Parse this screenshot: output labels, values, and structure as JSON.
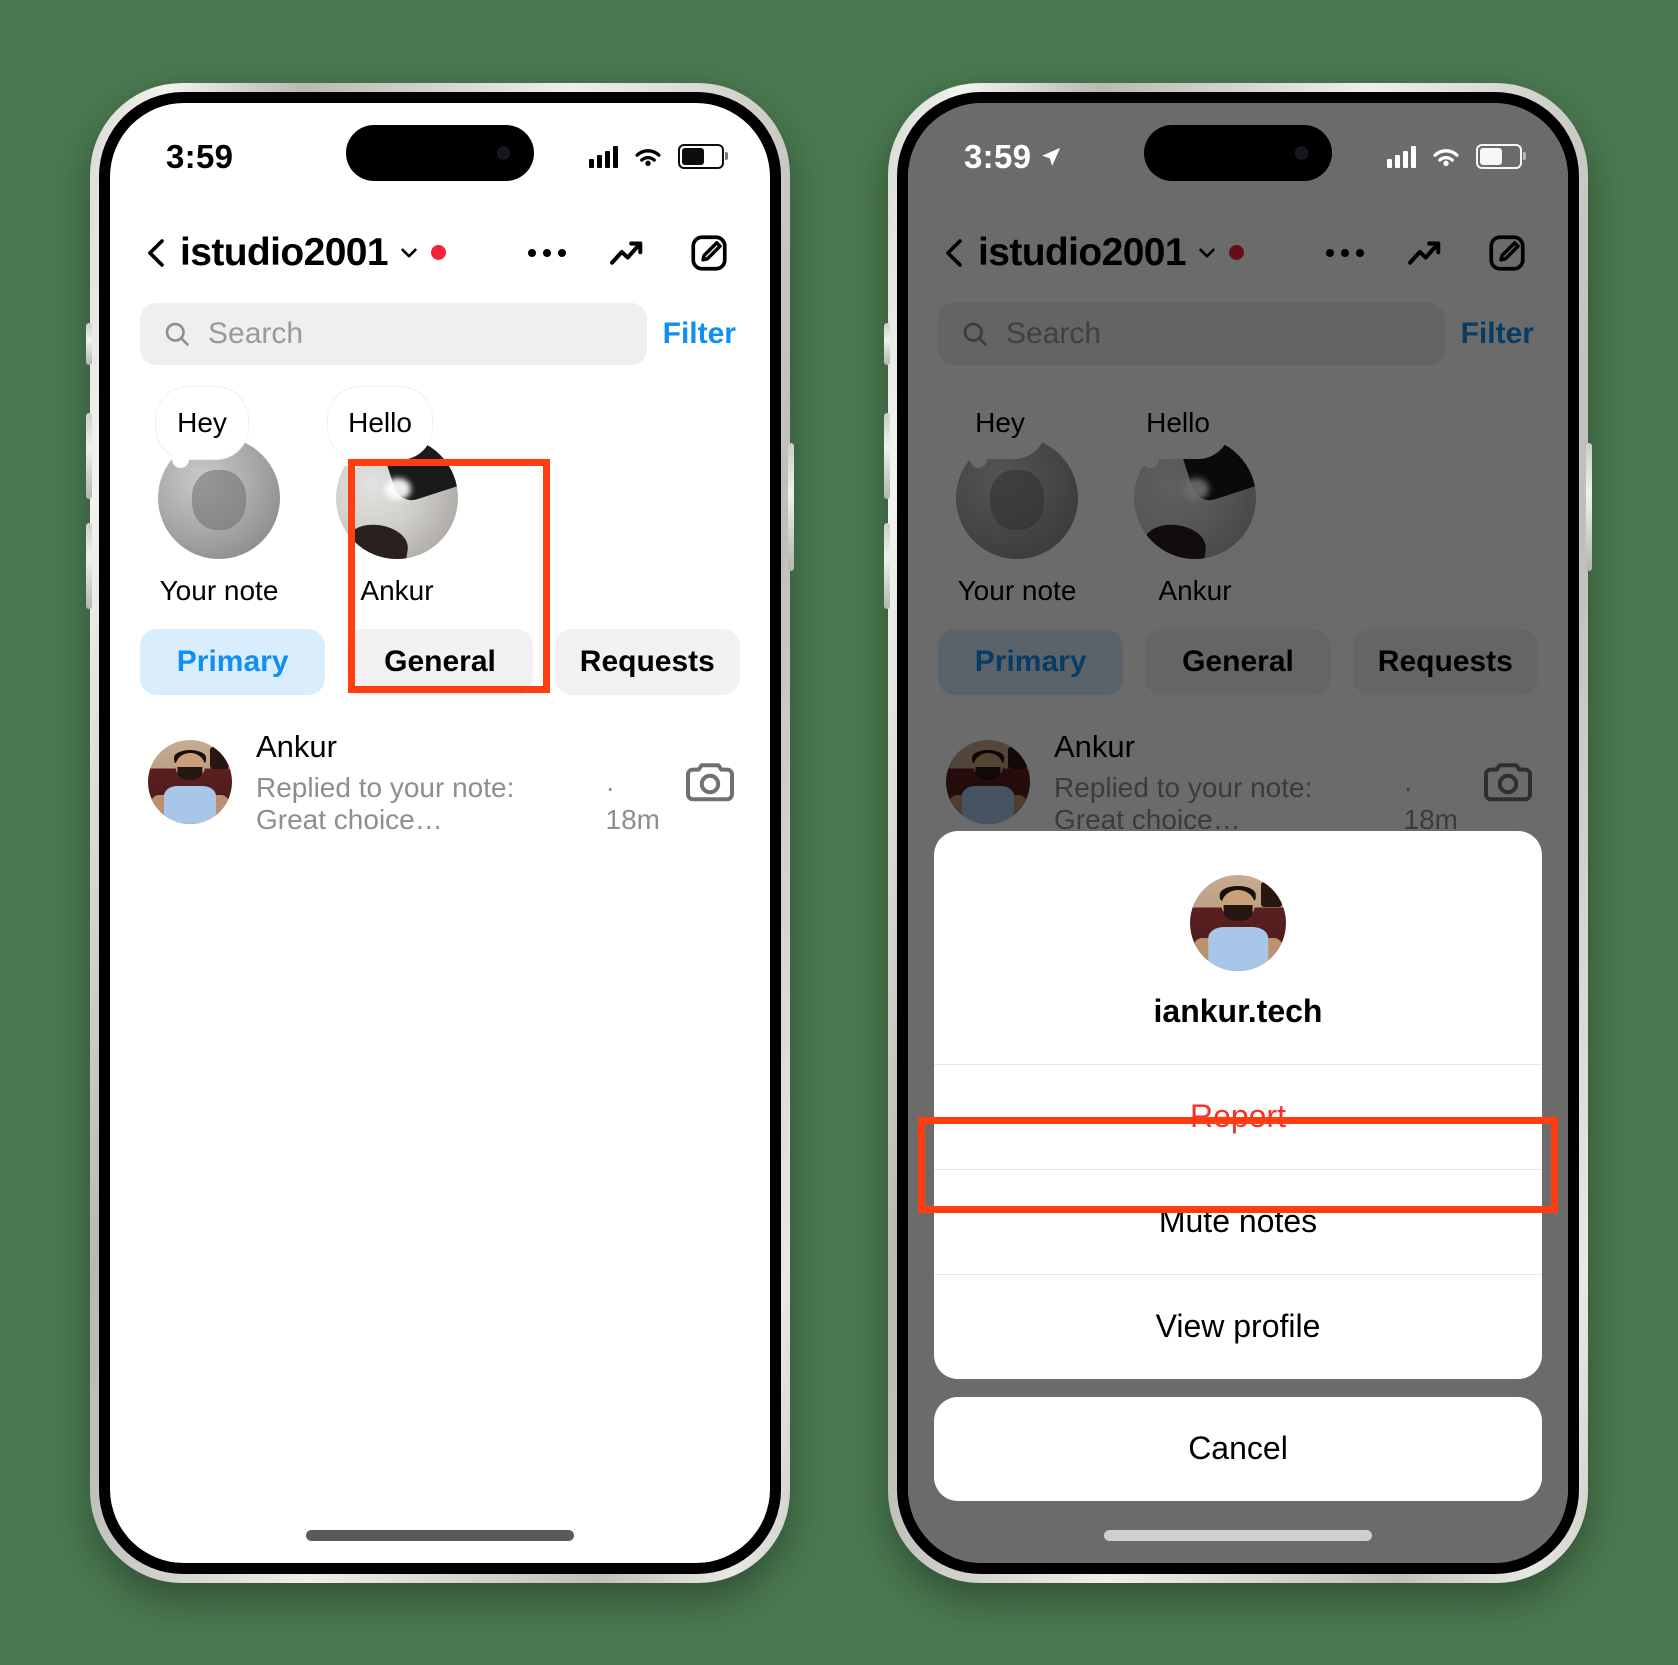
{
  "background_color": "#4a7950",
  "accent_blue": "#0f90f2",
  "danger_red": "#ff2d26",
  "highlight_red": "#ff3d11",
  "screens": [
    {
      "id": "inbox",
      "status": {
        "time": "3:59",
        "location_arrow": false,
        "signal_icon": "cellular-bars-icon",
        "wifi_icon": "wifi-icon",
        "battery_icon": "battery-icon",
        "battery_level": 62
      },
      "nav": {
        "back_icon": "back-chevron-icon",
        "title": "istudio2001",
        "caret_icon": "chevron-down-icon",
        "unread_dot": true,
        "more_icon": "more-dots-icon",
        "insights_icon": "trending-up-icon",
        "compose_icon": "compose-pencil-icon"
      },
      "search": {
        "placeholder": "Search",
        "icon": "search-icon",
        "filter_label": "Filter"
      },
      "notes": [
        {
          "bubble": "Hey",
          "name": "Your note",
          "avatar": "apple-logo-orb"
        },
        {
          "bubble": "Hello",
          "name": "Ankur",
          "avatar": "room-photo-orb"
        }
      ],
      "tabs": [
        {
          "label": "Primary",
          "selected": true
        },
        {
          "label": "General",
          "selected": false
        },
        {
          "label": "Requests",
          "selected": false
        }
      ],
      "messages": [
        {
          "name": "Ankur",
          "preview": "Replied to your note: Great choice…",
          "time": "· 18m",
          "camera_icon": "camera-icon"
        }
      ],
      "home_indicator": "home-indicator"
    },
    {
      "id": "action-sheet",
      "status": {
        "time": "3:59",
        "location_arrow": true,
        "signal_icon": "cellular-bars-icon",
        "wifi_icon": "wifi-icon",
        "battery_icon": "battery-icon",
        "battery_level": 62
      },
      "nav": {
        "back_icon": "back-chevron-icon",
        "title": "istudio2001",
        "caret_icon": "chevron-down-icon",
        "unread_dot": true,
        "more_icon": "more-dots-icon",
        "insights_icon": "trending-up-icon",
        "compose_icon": "compose-pencil-icon"
      },
      "search": {
        "placeholder": "Search",
        "icon": "search-icon",
        "filter_label": "Filter"
      },
      "notes": [
        {
          "bubble": "Hey",
          "name": "Your note",
          "avatar": "apple-logo-orb"
        },
        {
          "bubble": "Hello",
          "name": "Ankur",
          "avatar": "room-photo-orb"
        }
      ],
      "tabs": [
        {
          "label": "Primary",
          "selected": true
        },
        {
          "label": "General",
          "selected": false
        },
        {
          "label": "Requests",
          "selected": false
        }
      ],
      "messages": [
        {
          "name": "Ankur",
          "preview": "Replied to your note: Great choice…",
          "time": "· 18m",
          "camera_icon": "camera-icon"
        }
      ],
      "sheet": {
        "handle": "iankur.tech",
        "avatar": "profile-photo",
        "items": [
          {
            "label": "Report",
            "style": "danger"
          },
          {
            "label": "Mute notes",
            "style": "normal",
            "highlighted": true
          },
          {
            "label": "View profile",
            "style": "normal"
          }
        ],
        "cancel_label": "Cancel"
      },
      "home_indicator": "home-indicator"
    }
  ]
}
